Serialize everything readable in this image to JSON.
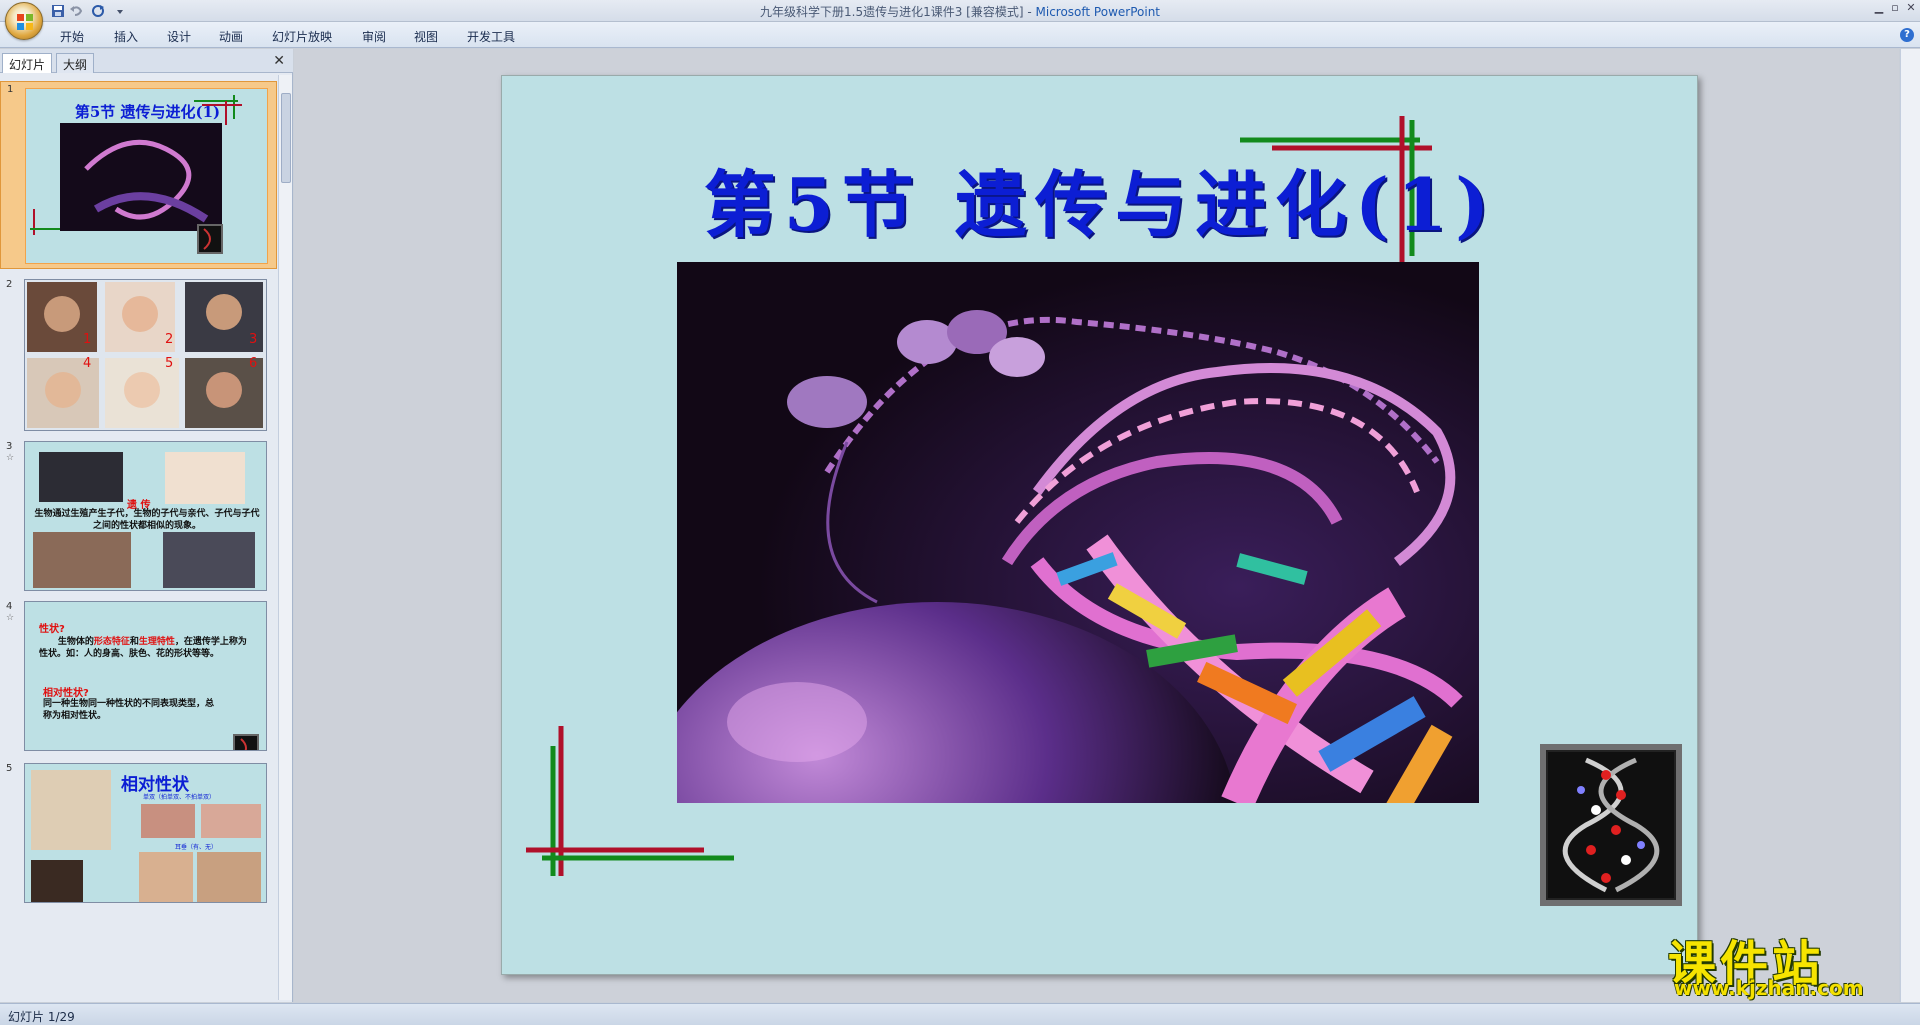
{
  "window": {
    "document_title": "九年级科学下册1.5遗传与进化1课件3 [兼容模式] - ",
    "app_name": "Microsoft PowerPoint"
  },
  "ribbon": {
    "tabs": [
      "开始",
      "插入",
      "设计",
      "动画",
      "幻灯片放映",
      "审阅",
      "视图",
      "开发工具"
    ]
  },
  "left_pane": {
    "tabs": [
      "幻灯片",
      "大纲"
    ],
    "thumbnails": [
      {
        "num": "1",
        "title": "第5节   遗传与进化(1)"
      },
      {
        "num": "2",
        "labels": [
          "1",
          "2",
          "3",
          "4",
          "5",
          "6"
        ]
      },
      {
        "num": "3",
        "star": "☆",
        "heading": "遗 传",
        "text": "生物通过生殖产生子代，生物的子代与亲代、子代与子代之间的性状都相似的现象。"
      },
      {
        "num": "4",
        "star": "☆",
        "q1": "性状?",
        "p1a": "生物体的",
        "p1b": "形态特征",
        "p1c": "和",
        "p1d": "生理特性",
        "p1e": "，在遗传学上称为性状。如：人的身高、肤色、花的形状等等。",
        "q2": "相对性状?",
        "p2": "同一种生物同一种性状的不同表现类型，总称为相对性状。"
      },
      {
        "num": "5",
        "title": "相对性状",
        "sub1": "单双（拍单双、不拍单双）",
        "sub2": "耳垂（有、无）"
      }
    ]
  },
  "slide": {
    "title": "第5节   遗传与进化(1)"
  },
  "status": {
    "text": "幻灯片 1/29"
  },
  "watermark": {
    "main": "课件站",
    "url": "www.kjzhan.com"
  },
  "colors": {
    "slide_bg": "#bde0e4",
    "title_blue": "#0c1ed4",
    "accent_red": "#b0102a",
    "accent_green": "#128a1c"
  }
}
